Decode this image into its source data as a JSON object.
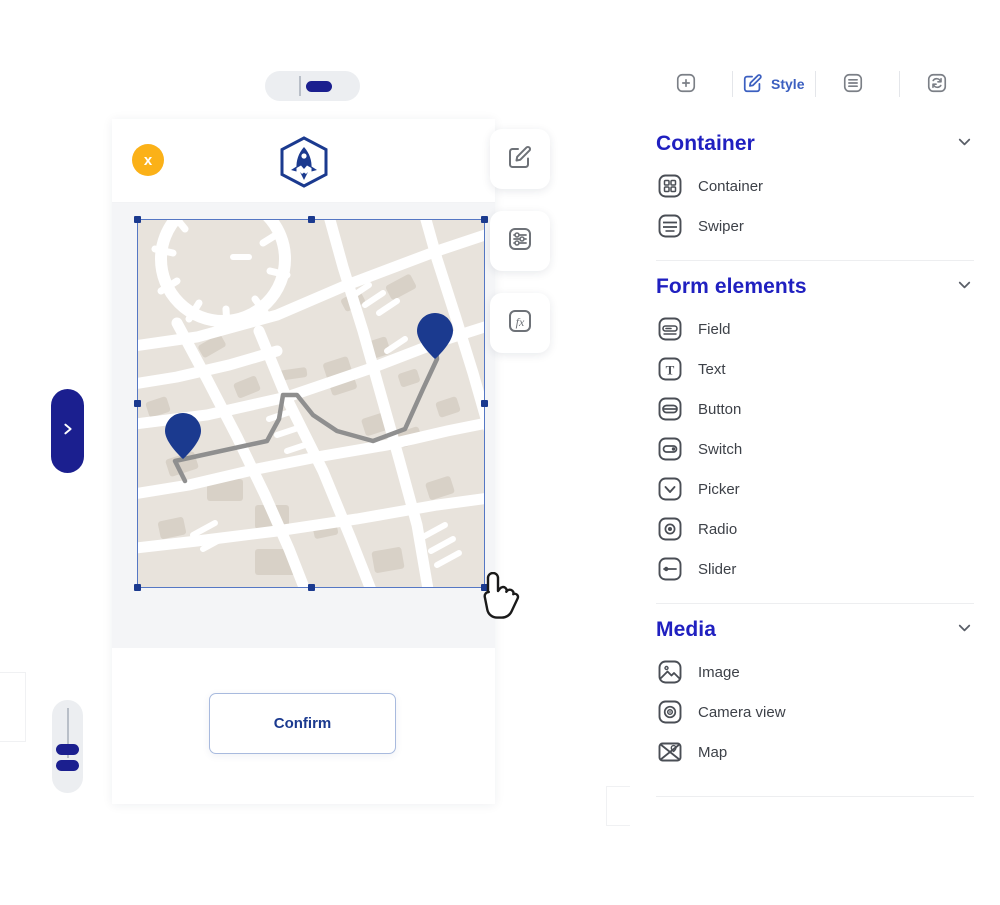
{
  "canvas": {
    "top_handle": {
      "name": "drag-handle"
    },
    "phone": {
      "close_label": "x",
      "logo_name": "rocket-logo",
      "map_widget": {
        "name": "map-component",
        "selected": true,
        "pins": 2,
        "route": true
      },
      "confirm_label": "Confirm"
    },
    "float_tools": [
      {
        "icon": "edit-icon",
        "label": "Edit"
      },
      {
        "icon": "sliders-icon",
        "label": "Settings"
      },
      {
        "icon": "fx-icon",
        "label": "Functions"
      }
    ],
    "nav_pill": {
      "icon": "chevron-right-icon"
    },
    "vertical_slider": {
      "name": "zoom-slider"
    }
  },
  "right_panel": {
    "tabs": [
      {
        "id": "add",
        "label": "",
        "icon": "plus-icon",
        "active": false
      },
      {
        "id": "style",
        "label": "Style",
        "icon": "edit-square-icon",
        "active": true
      },
      {
        "id": "layers",
        "label": "",
        "icon": "list-icon",
        "active": false
      },
      {
        "id": "sync",
        "label": "",
        "icon": "refresh-icon",
        "active": false
      }
    ],
    "groups": [
      {
        "title": "Container",
        "expanded": true,
        "items": [
          {
            "label": "Container",
            "icon": "container-icon"
          },
          {
            "label": "Swiper",
            "icon": "swiper-icon"
          }
        ]
      },
      {
        "title": "Form elements",
        "expanded": true,
        "items": [
          {
            "label": "Field",
            "icon": "field-icon"
          },
          {
            "label": "Text",
            "icon": "text-icon"
          },
          {
            "label": "Button",
            "icon": "button-icon"
          },
          {
            "label": "Switch",
            "icon": "switch-icon"
          },
          {
            "label": "Picker",
            "icon": "picker-icon"
          },
          {
            "label": "Radio",
            "icon": "radio-icon"
          },
          {
            "label": "Slider",
            "icon": "slider-icon"
          }
        ]
      },
      {
        "title": "Media",
        "expanded": true,
        "items": [
          {
            "label": "Image",
            "icon": "image-icon"
          },
          {
            "label": "Camera view",
            "icon": "camera-icon"
          },
          {
            "label": "Map",
            "icon": "map-icon"
          }
        ]
      }
    ]
  },
  "colors": {
    "brand_blue": "#1b1f8f",
    "accent_blue": "#2020c0",
    "tab_active": "#3b5fc0",
    "warning_amber": "#fbb118",
    "map_bg": "#e8e3dc",
    "map_road": "#ffffff",
    "pin": "#1b3a8f",
    "selection": "#5577c4"
  }
}
